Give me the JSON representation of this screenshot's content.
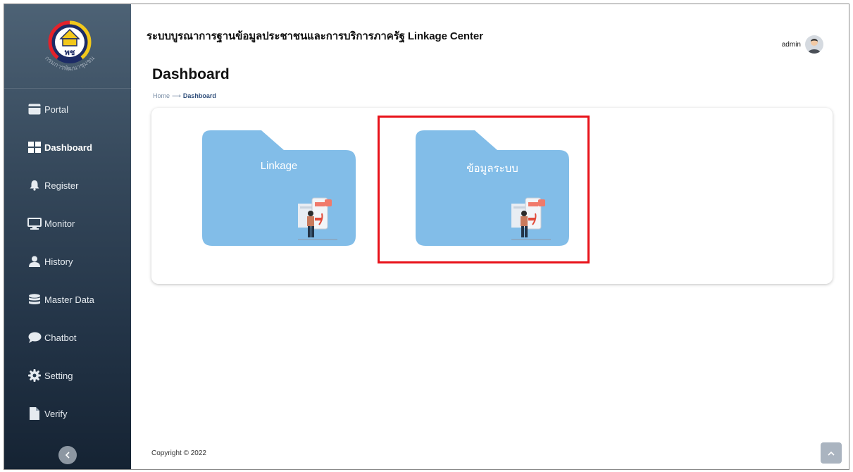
{
  "header": {
    "app_title": "ระบบบูรณาการฐานข้อมูลประชาชนและการบริการภาครัฐ Linkage Center",
    "user_name": "admin"
  },
  "logo": {
    "caption": "กรมการพัฒนาชุมชน",
    "emblem_text": "พช"
  },
  "sidebar": {
    "items": [
      {
        "label": "Portal",
        "icon": "portal-icon",
        "active": false
      },
      {
        "label": "Dashboard",
        "icon": "dashboard-grid-icon",
        "active": true
      },
      {
        "label": "Register",
        "icon": "bell-icon",
        "active": false
      },
      {
        "label": "Monitor",
        "icon": "monitor-icon",
        "active": false
      },
      {
        "label": "History",
        "icon": "user-icon",
        "active": false
      },
      {
        "label": "Master Data",
        "icon": "database-icon",
        "active": false
      },
      {
        "label": "Chatbot",
        "icon": "chat-bubble-icon",
        "active": false
      },
      {
        "label": "Setting",
        "icon": "gear-icon",
        "active": false
      },
      {
        "label": "Verify",
        "icon": "file-icon",
        "active": false
      }
    ]
  },
  "page": {
    "title": "Dashboard",
    "breadcrumb": {
      "home": "Home",
      "separator": "⟶",
      "current": "Dashboard"
    }
  },
  "cards": [
    {
      "label": "Linkage",
      "color": "#82bde8"
    },
    {
      "label": "ข้อมูลระบบ",
      "color": "#82bde8"
    }
  ],
  "footer": {
    "copyright": "Copyright © 2022"
  },
  "colors": {
    "sidebar_top": "#4d6275",
    "sidebar_bottom": "#152333",
    "folder": "#82bde8",
    "highlight": "#e8121a"
  }
}
